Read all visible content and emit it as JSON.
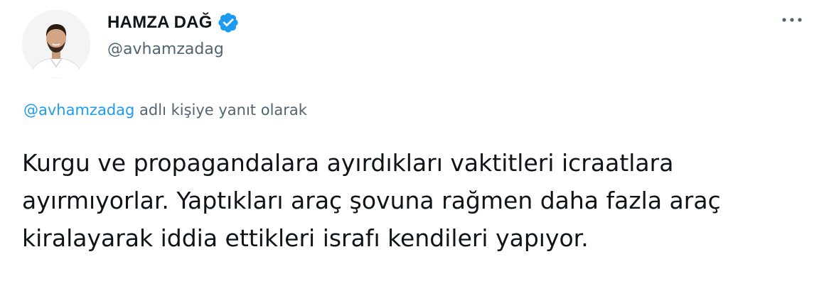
{
  "author": {
    "display_name": "HAMZA DAĞ",
    "handle": "@avhamzadag",
    "verified": true,
    "avatar_icon": "profile-photo"
  },
  "menu": {
    "more_icon": "more-horizontal-icon"
  },
  "reply_context": {
    "mention": "@avhamzadag",
    "suffix": " adlı kişiye yanıt olarak"
  },
  "tweet": {
    "text": "Kurgu ve propagandalara ayırdıkları vaktitleri icraatlara ayırmıyorlar. Yaptıkları araç şovuna rağmen daha fazla araç kiralayarak iddia ettikleri israfı kendileri yapıyor."
  },
  "colors": {
    "verified_blue": "#1d9bf0",
    "link_blue": "#1d9bf0",
    "secondary_text": "#536471",
    "primary_text": "#0f1419"
  }
}
